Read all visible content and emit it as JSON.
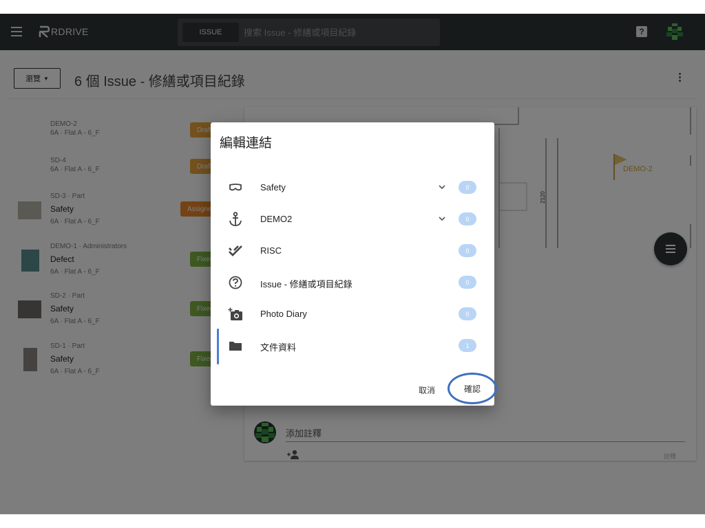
{
  "app": {
    "logo_text": "RDRIVE"
  },
  "search": {
    "chip_label": "ISSUE",
    "placeholder": "搜索 Issue - 修繕或項目紀錄"
  },
  "header": {
    "browse_label": "瀏覽",
    "title": "6 個 Issue - 修繕或項目紀錄"
  },
  "issues": [
    {
      "id": "DEMO-2",
      "name": "",
      "location": "6A · Flat A - 6_F",
      "status": "Draft",
      "status_color": "#e8a33a"
    },
    {
      "id": "SD-4",
      "name": "",
      "location": "6A · Flat A - 6_F",
      "status": "Draft",
      "status_color": "#e8a33a"
    },
    {
      "id": "SD-3 · Part",
      "name": "Safety",
      "location": "6A · Flat A - 6_F",
      "status": "Assigned",
      "status_color": "#e8862a"
    },
    {
      "id": "DEMO-1 · Administrators",
      "name": "Defect",
      "location": "6A · Flat A - 6_F",
      "status": "Fixed",
      "status_color": "#7cb342"
    },
    {
      "id": "SD-2 · Part",
      "name": "Safety",
      "location": "6A · Flat A - 6_F",
      "status": "Fixed",
      "status_color": "#7cb342"
    },
    {
      "id": "SD-1 · Part",
      "name": "Safety",
      "location": "6A · Flat A - 6_F",
      "status": "Fixed",
      "status_color": "#7cb342"
    }
  ],
  "drawing": {
    "flag_label": "DEMO-2",
    "dimension": "2120"
  },
  "comment": {
    "placeholder": "添加註釋",
    "submit_label": "註釋"
  },
  "dialog": {
    "title": "編輯連結",
    "links": [
      {
        "label": "Safety",
        "count": "0",
        "icon": "goggles-icon",
        "expandable": true
      },
      {
        "label": "DEMO2",
        "count": "0",
        "icon": "anchor-icon",
        "expandable": true
      },
      {
        "label": "RISC",
        "count": "0",
        "icon": "double-check-icon",
        "expandable": false
      },
      {
        "label": "Issue - 修繕或項目紀錄",
        "count": "0",
        "icon": "help-circle-icon",
        "expandable": false
      },
      {
        "label": "Photo Diary",
        "count": "0",
        "icon": "add-camera-icon",
        "expandable": false
      },
      {
        "label": "文件資料",
        "count": "1",
        "icon": "folder-icon",
        "expandable": false
      }
    ],
    "cancel_label": "取消",
    "confirm_label": "確認"
  },
  "colors": {
    "topbar": "#2f3437",
    "accent": "#3f6fc0",
    "badge": "#b9d5f5"
  }
}
